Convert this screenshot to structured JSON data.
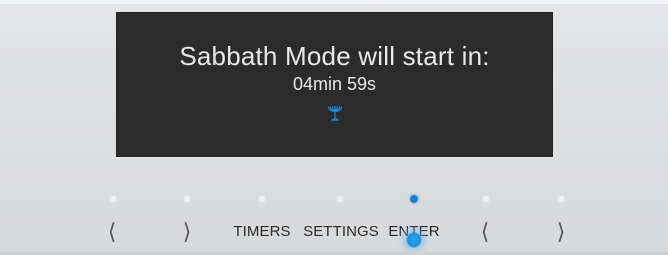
{
  "display": {
    "message": "Sabbath Mode will start in:",
    "countdown": "04min 59s",
    "status_icon": "menorah-icon"
  },
  "controls": {
    "left_arrow_1": "⟨",
    "right_arrow_1": "⟩",
    "timers_label": "TIMERS",
    "settings_label": "SETTINGS",
    "enter_label": "ENTER",
    "left_arrow_2": "⟨",
    "right_arrow_2": "⟩"
  },
  "indicators": {
    "active_index": 4,
    "count": 7
  },
  "colors": {
    "display_background": "#2b2b2b",
    "display_text": "#e8e8e8",
    "accent_blue": "#1f7fd1",
    "panel_background": "#dddee0"
  }
}
